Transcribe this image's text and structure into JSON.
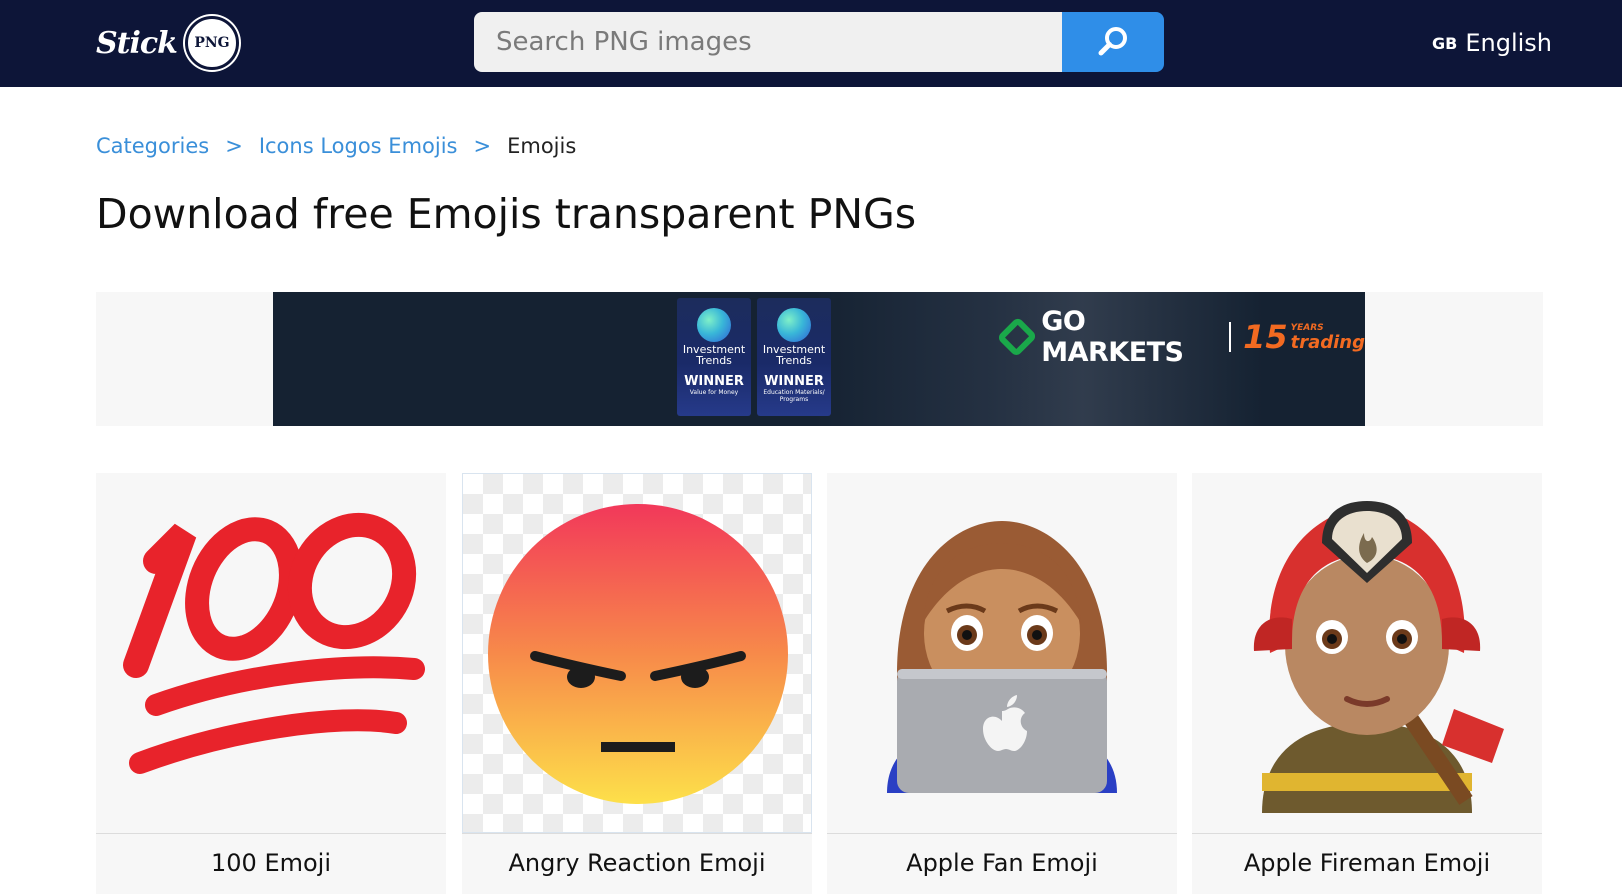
{
  "header": {
    "logo_text": "Stick",
    "logo_badge": "PNG",
    "search_placeholder": "Search PNG images",
    "language_code": "GB",
    "language_label": "English"
  },
  "breadcrumb": {
    "items": [
      "Categories",
      "Icons Logos Emojis"
    ],
    "separator": ">",
    "current": "Emojis"
  },
  "page_title": "Download free Emojis transparent PNGs",
  "ad": {
    "awards": [
      {
        "brand_line1": "Investment",
        "brand_line2": "Trends",
        "title": "WINNER",
        "subtitle": "Value for Money"
      },
      {
        "brand_line1": "Investment",
        "brand_line2": "Trends",
        "title": "WINNER",
        "subtitle": "Education Materials/ Programs"
      }
    ],
    "company": "GO MARKETS",
    "years_number": "15",
    "years_label": "YEARS",
    "years_word": "trading",
    "colors": {
      "background": "#152232",
      "brand_green": "#1aa84a",
      "brand_orange": "#f26a21"
    }
  },
  "cards": [
    {
      "title": "100 Emoji",
      "icon": "hundred-points-emoji"
    },
    {
      "title": "Angry Reaction Emoji",
      "icon": "angry-face-emoji"
    },
    {
      "title": "Apple Fan Emoji",
      "icon": "woman-laptop-emoji"
    },
    {
      "title": "Apple Fireman Emoji",
      "icon": "firefighter-emoji"
    }
  ],
  "colors": {
    "header_bg": "#0d1538",
    "accent": "#2f8ee8",
    "link": "#3a8fd9"
  }
}
